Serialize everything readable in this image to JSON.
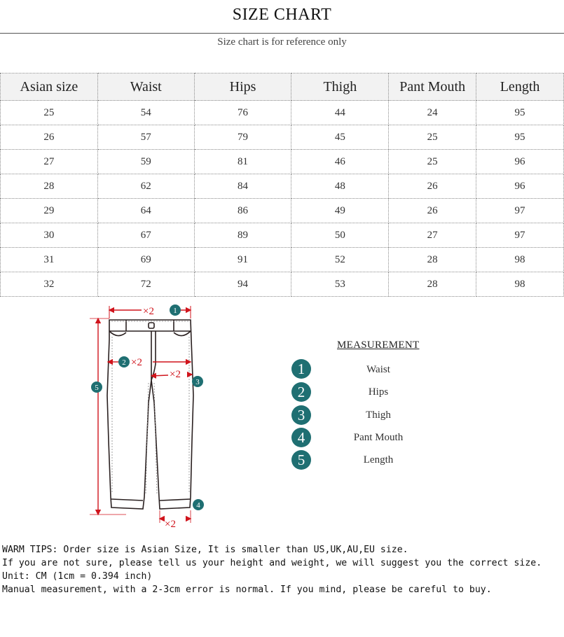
{
  "header": {
    "title": "SIZE CHART",
    "subtitle": "Size chart is for reference only"
  },
  "size_table": {
    "columns": [
      "Asian size",
      "Waist",
      "Hips",
      "Thigh",
      "Pant Mouth",
      "Length"
    ],
    "rows": [
      [
        "25",
        "54",
        "76",
        "44",
        "24",
        "95"
      ],
      [
        "26",
        "57",
        "79",
        "45",
        "25",
        "95"
      ],
      [
        "27",
        "59",
        "81",
        "46",
        "25",
        "96"
      ],
      [
        "28",
        "62",
        "84",
        "48",
        "26",
        "96"
      ],
      [
        "29",
        "64",
        "86",
        "49",
        "26",
        "97"
      ],
      [
        "30",
        "67",
        "89",
        "50",
        "27",
        "97"
      ],
      [
        "31",
        "69",
        "91",
        "52",
        "28",
        "98"
      ],
      [
        "32",
        "72",
        "94",
        "53",
        "28",
        "98"
      ]
    ]
  },
  "diagram": {
    "multiplier_label": "×2",
    "markers": [
      "1",
      "2",
      "3",
      "4",
      "5"
    ],
    "accent_color": "#d0141c",
    "badge_color": "#1f6f72"
  },
  "measurement": {
    "title": "MEASUREMENT",
    "items": [
      {
        "number": "1",
        "label": "Waist"
      },
      {
        "number": "2",
        "label": "Hips"
      },
      {
        "number": "3",
        "label": "Thigh"
      },
      {
        "number": "4",
        "label": "Pant Mouth"
      },
      {
        "number": "5",
        "label": "Length"
      }
    ]
  },
  "tips": [
    "WARM TIPS: Order size is Asian Size, It is smaller than US,UK,AU,EU size.",
    "If you are not sure, please tell us your height and weight, we will suggest you the correct size.",
    "Unit: CM (1cm = 0.394 inch)",
    "Manual measurement, with a 2-3cm error is normal. If you mind, please be careful to buy."
  ]
}
